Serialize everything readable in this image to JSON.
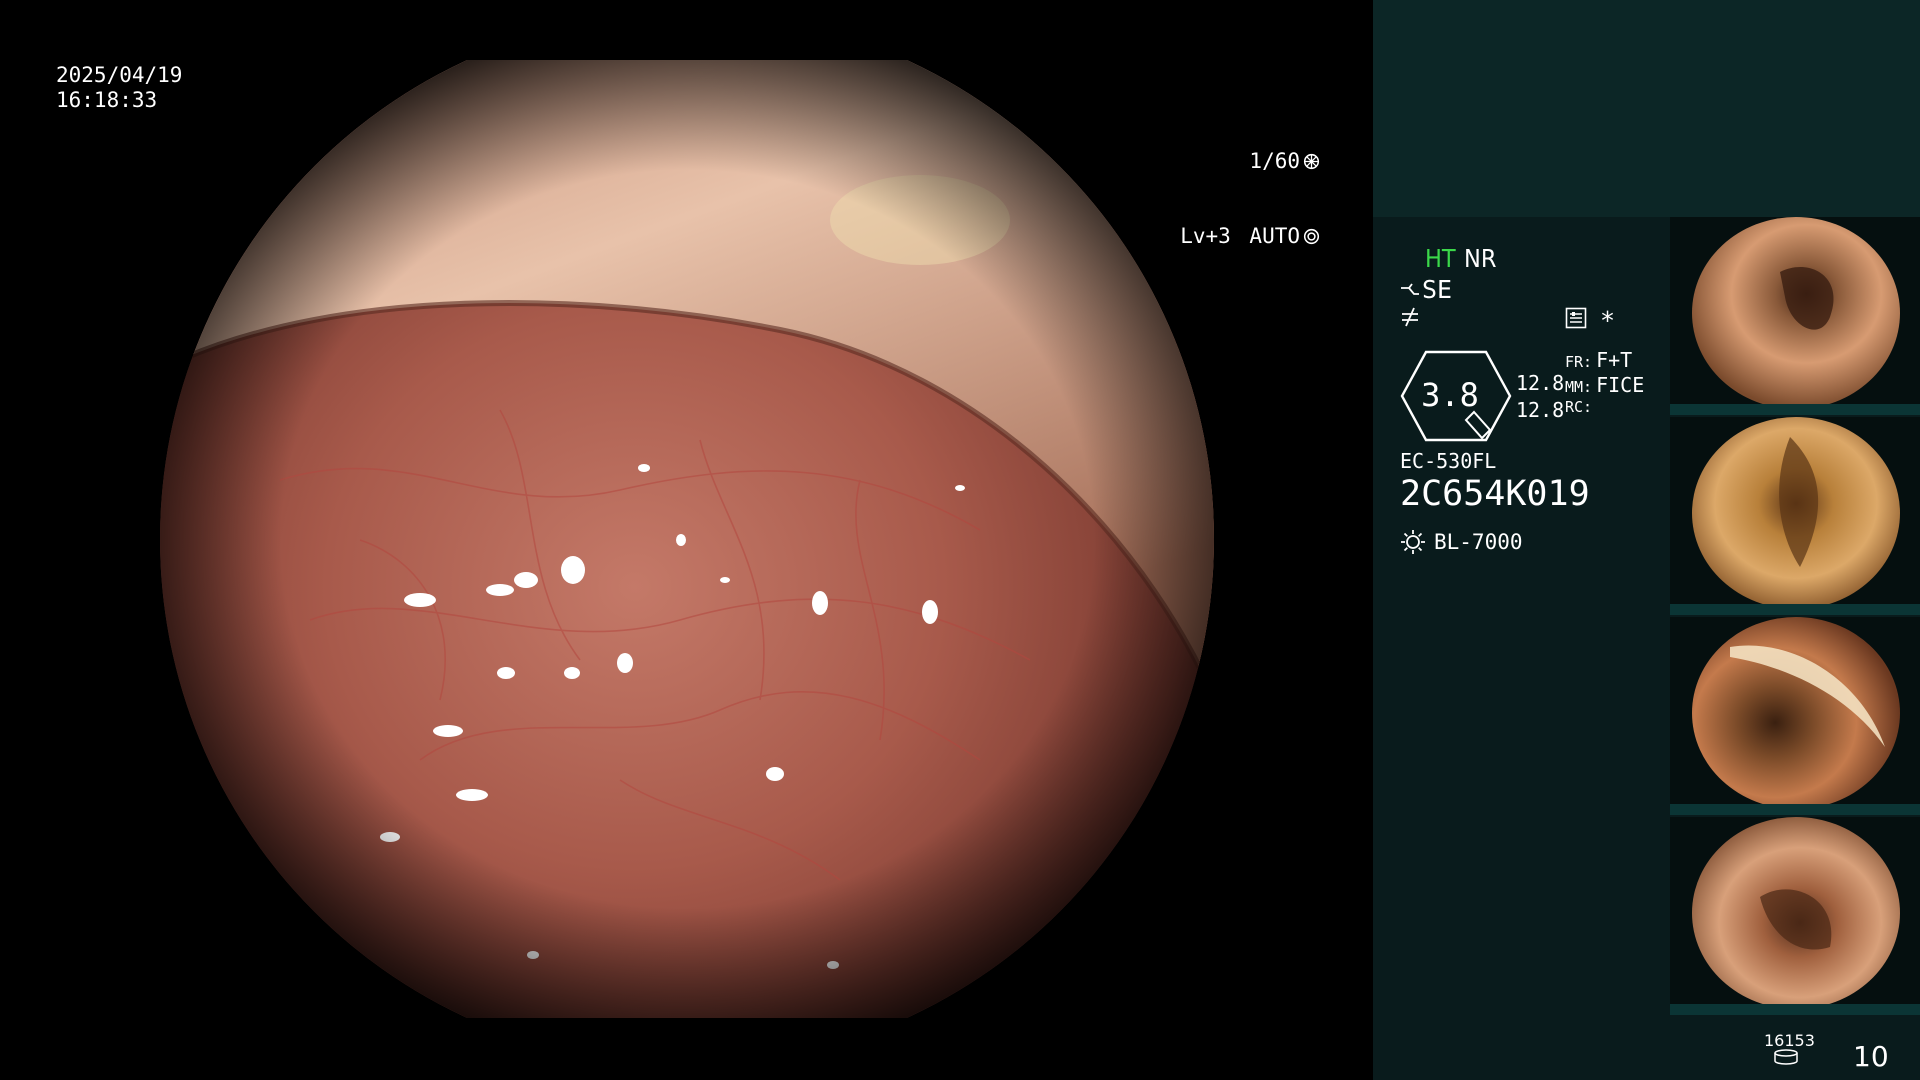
{
  "osd": {
    "date": "2025/04/19",
    "time": "16:18:33",
    "shutter": "1/60",
    "level": "Lv+3",
    "iris_mode": "AUTO"
  },
  "status": {
    "ht": "HT",
    "nr": "NR",
    "se": "SE",
    "star": "*",
    "zoom_value": "3.8",
    "value_a": "12.8",
    "value_b": "12.8",
    "fr_key": "FR:",
    "fr_value": "F+T",
    "mm_key": "MM:",
    "mm_value": "FICE",
    "rc_key": "RC:",
    "rc_value": "",
    "scope_model": "EC-530FL",
    "scope_serial": "2C654K019",
    "light_source": "BL-7000"
  },
  "thumbnails_label": "2C654K019",
  "footer": {
    "counter": "16153",
    "page_count": "10"
  },
  "colors": {
    "panel_top": "#0c2626",
    "panel": "#091b1c",
    "ht_green": "#3bd84a"
  },
  "icons": [
    "shutter-icon",
    "iris-icon",
    "se-icon",
    "freeze-icon",
    "bars-icon",
    "zoom-badge-icon",
    "light-icon",
    "disk-icon"
  ]
}
